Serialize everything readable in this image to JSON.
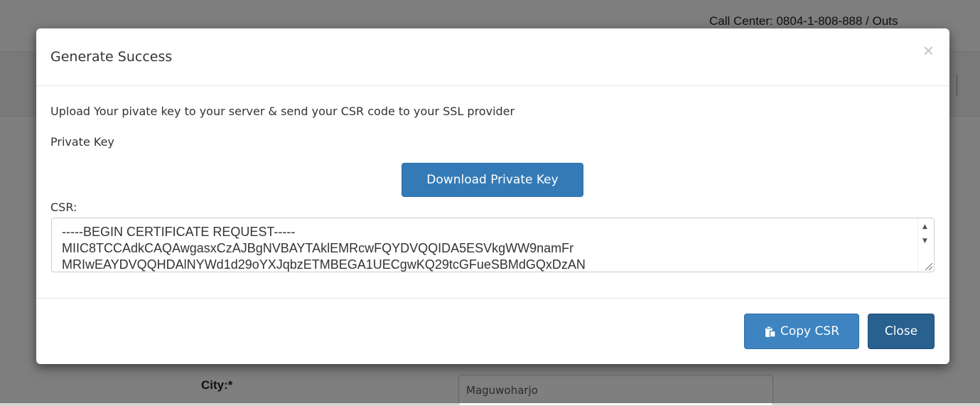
{
  "background": {
    "call_center": "Call Center: 0804-1-808-888 / Outs",
    "city_label": "City:*",
    "city_value": "Maguwoharjo"
  },
  "modal": {
    "title": "Generate Success",
    "close_symbol": "×",
    "intro": "Upload Your pivate key to your server & send your CSR code to your SSL provider",
    "private_key_label": "Private Key",
    "download_button": "Download Private Key",
    "csr_label": "CSR:",
    "csr_value": "-----BEGIN CERTIFICATE REQUEST-----\nMIIC8TCCAdkCAQAwgasxCzAJBgNVBAYTAklEMRcwFQYDVQQIDA5ESVkgWW9namFr\nMRIwEAYDVQQHDAlNYWd1d29oYXJqbzETMBEGA1UECgwKQ29tcGFueSBMdGQxDzAN",
    "copy_button": "Copy CSR",
    "close_button": "Close"
  },
  "icons": {
    "copy": "clipboard-icon",
    "close": "close-icon"
  },
  "colors": {
    "primary": "#337ab7",
    "close_button": "#286090",
    "backdrop": "rgba(0,0,0,0.5)"
  }
}
